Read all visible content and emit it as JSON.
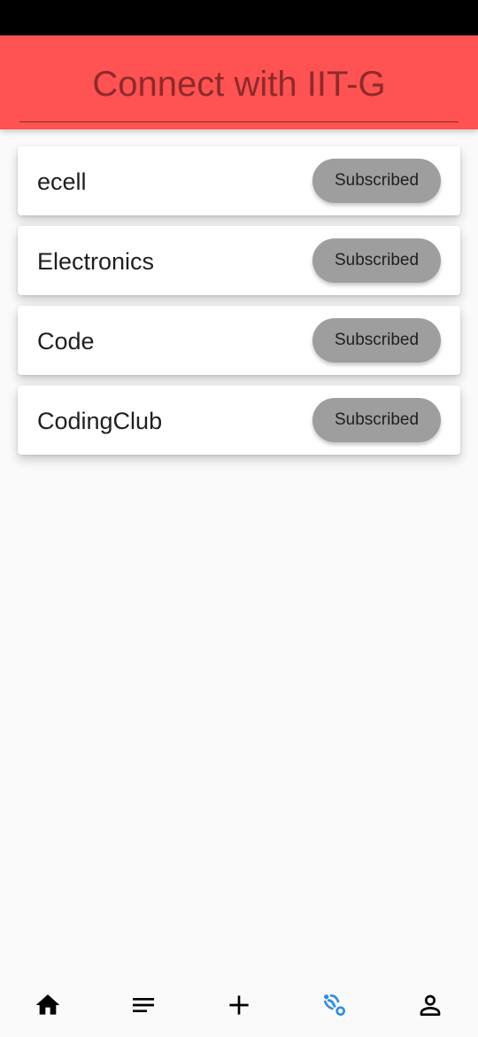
{
  "header": {
    "title": "Connect with IIT-G"
  },
  "clubs": [
    {
      "name": "ecell",
      "button_label": "Subscribed"
    },
    {
      "name": "Electronics",
      "button_label": "Subscribed"
    },
    {
      "name": "Code",
      "button_label": "Subscribed"
    },
    {
      "name": "CodingClub",
      "button_label": "Subscribed"
    }
  ],
  "bottom_nav": {
    "items": [
      {
        "icon": "home-icon"
      },
      {
        "icon": "feed-icon"
      },
      {
        "icon": "add-icon"
      },
      {
        "icon": "connect-icon",
        "active": true
      },
      {
        "icon": "profile-icon"
      }
    ]
  },
  "colors": {
    "status_bar": "#000000",
    "header_bg": "#ff5252",
    "header_text": "#8e2a2a",
    "button_bg": "#9e9e9e",
    "active_nav": "#2f8fe0"
  }
}
